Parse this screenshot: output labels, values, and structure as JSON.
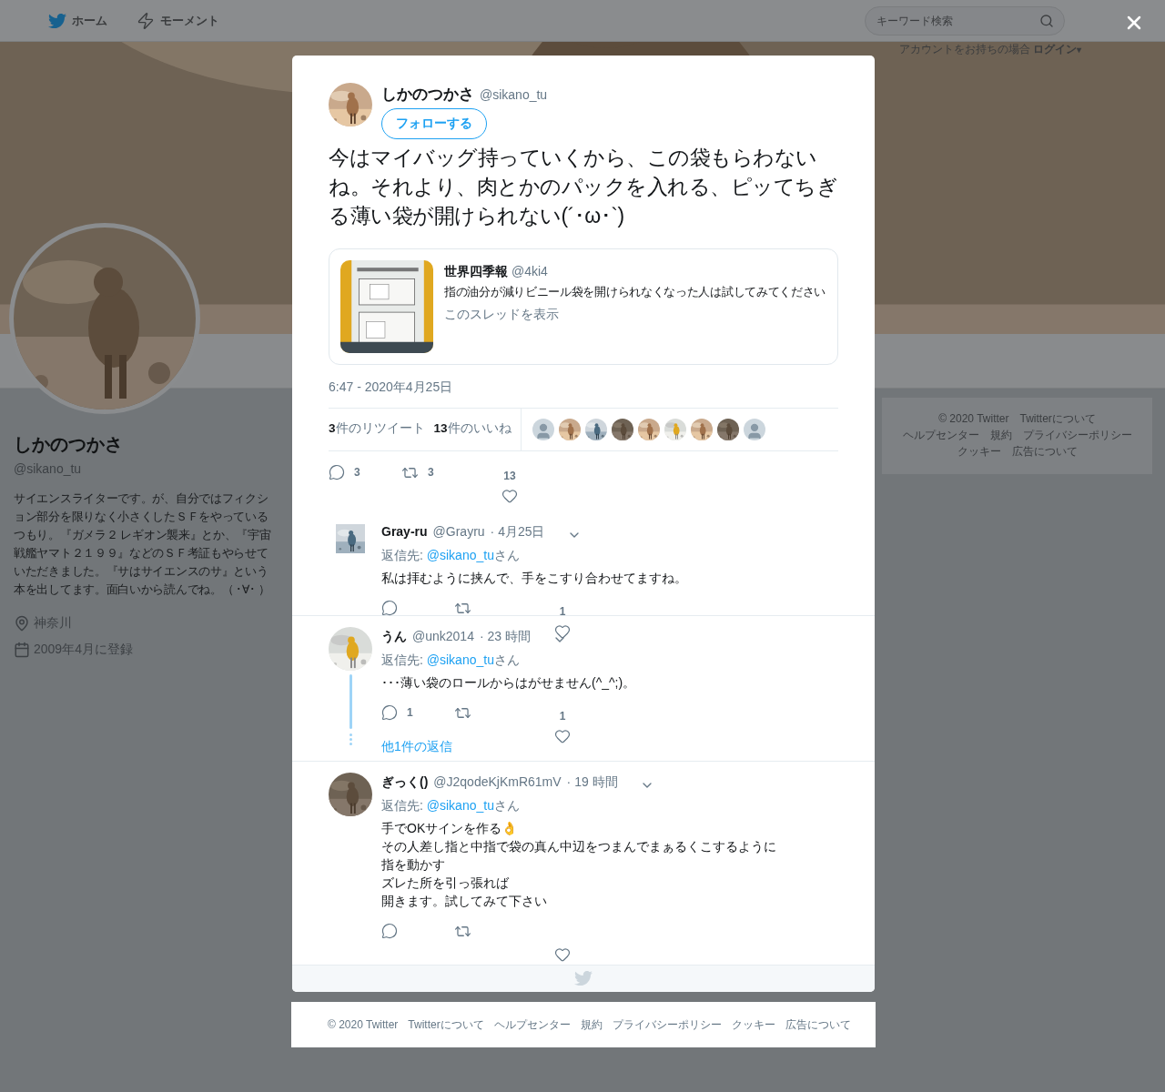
{
  "nav": {
    "items": [
      {
        "label": "ホーム",
        "kind": "home"
      },
      {
        "label": "モーメント",
        "kind": "moments"
      }
    ],
    "search_placeholder": "キーワード検索"
  },
  "login_prompt": {
    "text": "アカウントをお持ちの場合",
    "link": "ログイン",
    "caret": "▾"
  },
  "profile": {
    "name": "しかのつかさ",
    "handle": "@sikano_tu",
    "bio": "サイエンスライターです。が、自分ではフィクション部分を限りなく小さくしたＳＦをやっているつもり。『ガメラ２ レギオン襲来』とか、『宇宙戦艦ヤマト２１９９』などのＳＦ考証もやらせていただきました。『サはサイエンスのサ』という本を出してます。面白いから読んでね。（ ･∀･ ）",
    "location": "神奈川",
    "joined": "2009年4月に登録"
  },
  "side_footer": {
    "links": [
      "© 2020 Twitter",
      "Twitterについて",
      "ヘルプセンター",
      "規約",
      "プライバシーポリシー",
      "クッキー",
      "広告について"
    ]
  },
  "tweet": {
    "author_name": "しかのつかさ",
    "author_handle": "@sikano_tu",
    "follow_button": "フォローする",
    "text": "今はマイバッグ持っていくから、この袋もらわないね。それより、肉とかのパックを入れる、ピッてちぎる薄い袋が開けられない(´･ω･`)",
    "quote": {
      "name": "世界四季報",
      "handle": "@4ki4",
      "text": "指の油分が減りビニール袋を開けられなくなった人は試してみてください",
      "thread_link": "このスレッドを表示"
    },
    "timestamp": "6:47 - 2020年4月25日",
    "stats": [
      {
        "count": "3",
        "label": "件のリツイート"
      },
      {
        "count": "13",
        "label": "件のいいね"
      }
    ],
    "likers": [
      {
        "kind": "default"
      },
      {
        "kind": "picture"
      },
      {
        "kind": "picture"
      },
      {
        "kind": "picture"
      },
      {
        "kind": "picture"
      },
      {
        "kind": "picture"
      },
      {
        "kind": "picture"
      },
      {
        "kind": "picture"
      },
      {
        "kind": "default"
      }
    ],
    "actions": {
      "reply": "3",
      "retweet": "3",
      "like": "13"
    }
  },
  "replies": [
    {
      "name": "Gray-ru",
      "handle": "@Grayru",
      "time": "· 4月25日",
      "reply_to_prefix": "返信先: ",
      "reply_to": "@sikano_tu",
      "reply_to_suffix": "さん",
      "lines": [
        "私は拝むように挟んで、手をこすり合わせてますね。"
      ],
      "like_count": "1",
      "thread": false
    },
    {
      "name": "うん",
      "handle": "@unk2014",
      "time": "· 23 時間",
      "reply_to_prefix": "返信先: ",
      "reply_to": "@sikano_tu",
      "reply_to_suffix": "さん",
      "lines": [
        "･･･薄い袋のロールからはがせません(^_^;)。"
      ],
      "reply_count": "1",
      "like_count": "1",
      "thread": true,
      "more_replies": "他1件の返信"
    },
    {
      "name": "ぎっく()",
      "handle": "@J2qodeKjKmR61mV",
      "time": "· 19 時間",
      "reply_to_prefix": "返信先: ",
      "reply_to": "@sikano_tu",
      "reply_to_suffix": "さん",
      "lines": [
        "手でOKサインを作る👌",
        "その人差し指と中指で袋の真ん中辺をつまんでまぁるくこするように",
        "指を動かす",
        "ズレた所を引っ張れば",
        "開きます。試してみて下さい"
      ],
      "thread": false
    }
  ],
  "footer": {
    "links": [
      "© 2020 Twitter",
      "Twitterについて",
      "ヘルプセンター",
      "規約",
      "プライバシーポリシー",
      "クッキー",
      "広告について"
    ]
  }
}
